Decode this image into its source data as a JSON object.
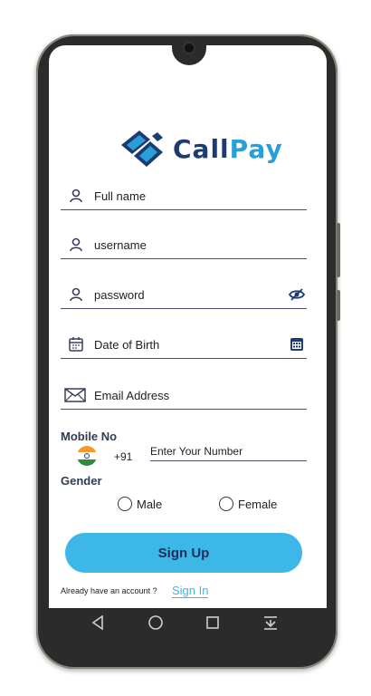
{
  "app": {
    "name_part1": "Call",
    "name_part2": "Pay",
    "brand_dark": "#1c3a74",
    "brand_light": "#2a9fd6"
  },
  "form": {
    "full_name": {
      "placeholder": "Full name",
      "icon": "person-icon"
    },
    "username": {
      "placeholder": "username",
      "icon": "person-icon"
    },
    "password": {
      "placeholder": "password",
      "icon": "person-icon",
      "toggle_icon": "eye-off-icon"
    },
    "dob": {
      "placeholder": "Date of Birth",
      "icon": "calendar-icon",
      "picker_icon": "calendar-icon"
    },
    "email": {
      "placeholder": "Email Address",
      "icon": "envelope-icon"
    },
    "mobile": {
      "label": "Mobile No",
      "country_code": "+91",
      "flag": "india-flag-icon",
      "placeholder": "Enter Your Number"
    },
    "gender": {
      "label": "Gender",
      "options": [
        "Male",
        "Female"
      ]
    }
  },
  "actions": {
    "signup_label": "Sign Up",
    "footer_text": "Already have an account ?",
    "signin_label": "Sign In"
  },
  "colors": {
    "accent": "#3db6e8",
    "line": "#4b4f6b"
  }
}
